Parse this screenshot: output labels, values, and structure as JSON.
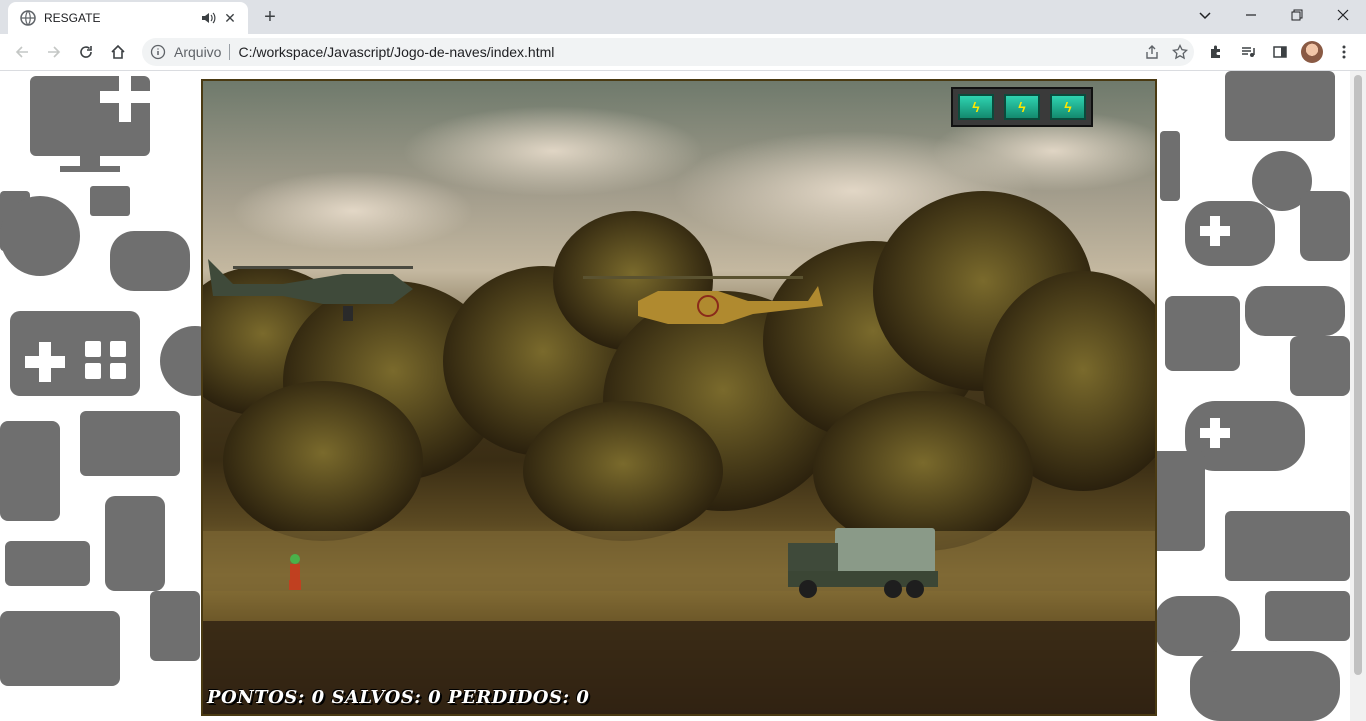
{
  "tab": {
    "title": "RESGATE",
    "close_glyph": "✕"
  },
  "newtab_glyph": "+",
  "toolbar": {
    "security_label": "Arquivo",
    "url": "C:/workspace/Javascript/Jogo-de-naves/index.html"
  },
  "game": {
    "hud_text": "PONTOS: 0 SALVOS: 0 PERDIDOS: 0",
    "energy_level": 1.0,
    "energy_glyph": "ϟ",
    "energy_cells": 3
  },
  "icons": [
    "globe-icon",
    "speaker-icon",
    "close-icon",
    "plus-icon",
    "chevron-down-icon",
    "minimize-icon",
    "restore-icon",
    "window-close-icon",
    "back-icon",
    "forward-icon",
    "reload-icon",
    "home-icon",
    "info-icon",
    "share-icon",
    "star-icon",
    "extensions-icon",
    "media-icon",
    "sidepanel-icon",
    "avatar"
  ]
}
